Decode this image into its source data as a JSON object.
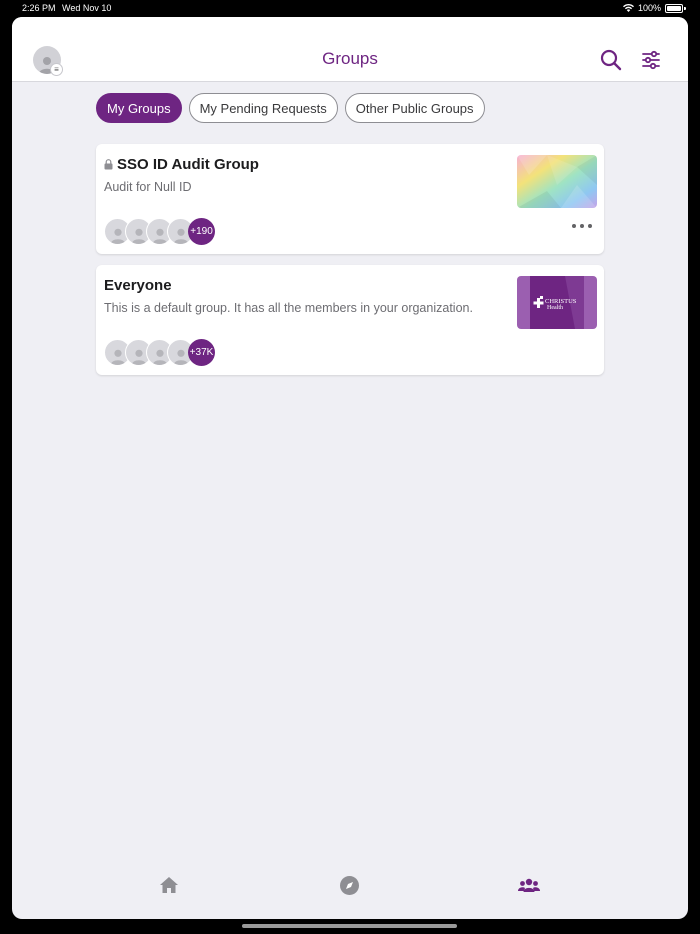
{
  "status_bar": {
    "time": "2:26 PM",
    "date": "Wed Nov 10",
    "battery": "100%"
  },
  "header": {
    "title": "Groups"
  },
  "tabs": [
    {
      "label": "My Groups",
      "active": true
    },
    {
      "label": "My Pending Requests",
      "active": false
    },
    {
      "label": "Other Public Groups",
      "active": false
    }
  ],
  "groups": [
    {
      "name": "SSO ID Audit Group",
      "locked": true,
      "description": "Audit for Null ID",
      "member_count": "+190",
      "thumbnail": "rainbow-gradient"
    },
    {
      "name": "Everyone",
      "locked": false,
      "description": "This is a default group. It has all the members in your organization.",
      "member_count": "+37K",
      "thumbnail": "christus-health-logo"
    }
  ],
  "thumb_logo": {
    "line1": "CHRISTUS",
    "line2": "Health"
  },
  "tab_bar": [
    {
      "icon": "home-icon"
    },
    {
      "icon": "compass-icon"
    },
    {
      "icon": "groups-icon",
      "active": true
    }
  ],
  "colors": {
    "accent": "#6e2582",
    "background": "#efeff4",
    "inactive_icon": "#8e8e93"
  }
}
